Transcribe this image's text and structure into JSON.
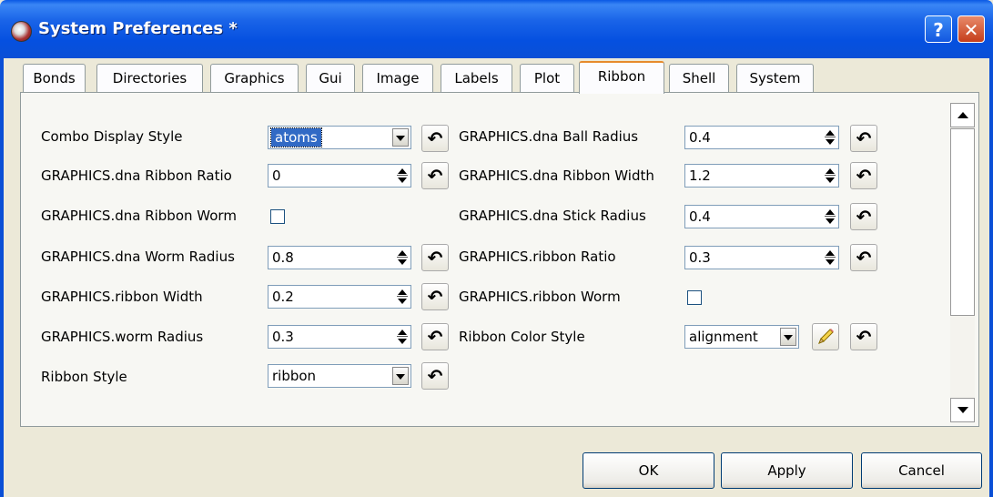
{
  "window": {
    "title": "System Preferences *",
    "help_glyph": "?",
    "close_glyph": "✕"
  },
  "tabs": [
    {
      "label": "Bonds"
    },
    {
      "label": "Directories"
    },
    {
      "label": "Graphics"
    },
    {
      "label": "Gui"
    },
    {
      "label": "Image"
    },
    {
      "label": "Labels"
    },
    {
      "label": "Plot"
    },
    {
      "label": "Ribbon",
      "active": true
    },
    {
      "label": "Shell"
    },
    {
      "label": "System"
    }
  ],
  "left": {
    "combo_display_style": {
      "label": "Combo Display Style",
      "value": "atoms"
    },
    "dna_ribbon_ratio": {
      "label": "GRAPHICS.dna Ribbon Ratio",
      "value": "0"
    },
    "dna_ribbon_worm": {
      "label": "GRAPHICS.dna Ribbon Worm",
      "checked": false
    },
    "dna_worm_radius": {
      "label": "GRAPHICS.dna Worm Radius",
      "value": "0.8"
    },
    "ribbon_width": {
      "label": "GRAPHICS.ribbon Width",
      "value": "0.2"
    },
    "worm_radius": {
      "label": "GRAPHICS.worm Radius",
      "value": "0.3"
    },
    "ribbon_style": {
      "label": "Ribbon Style",
      "value": "ribbon"
    }
  },
  "right": {
    "dna_ball_radius": {
      "label": "GRAPHICS.dna Ball Radius",
      "value": "0.4"
    },
    "dna_ribbon_width": {
      "label": "GRAPHICS.dna Ribbon Width",
      "value": "1.2"
    },
    "dna_stick_radius": {
      "label": "GRAPHICS.dna Stick Radius",
      "value": "0.4"
    },
    "ribbon_ratio": {
      "label": "GRAPHICS.ribbon Ratio",
      "value": "0.3"
    },
    "ribbon_worm": {
      "label": "GRAPHICS.ribbon Worm",
      "checked": false
    },
    "ribbon_color_style": {
      "label": "Ribbon Color Style",
      "value": "alignment"
    }
  },
  "icons": {
    "reset_glyph": "↶"
  },
  "buttons": {
    "ok": "OK",
    "apply": "Apply",
    "cancel": "Cancel"
  }
}
